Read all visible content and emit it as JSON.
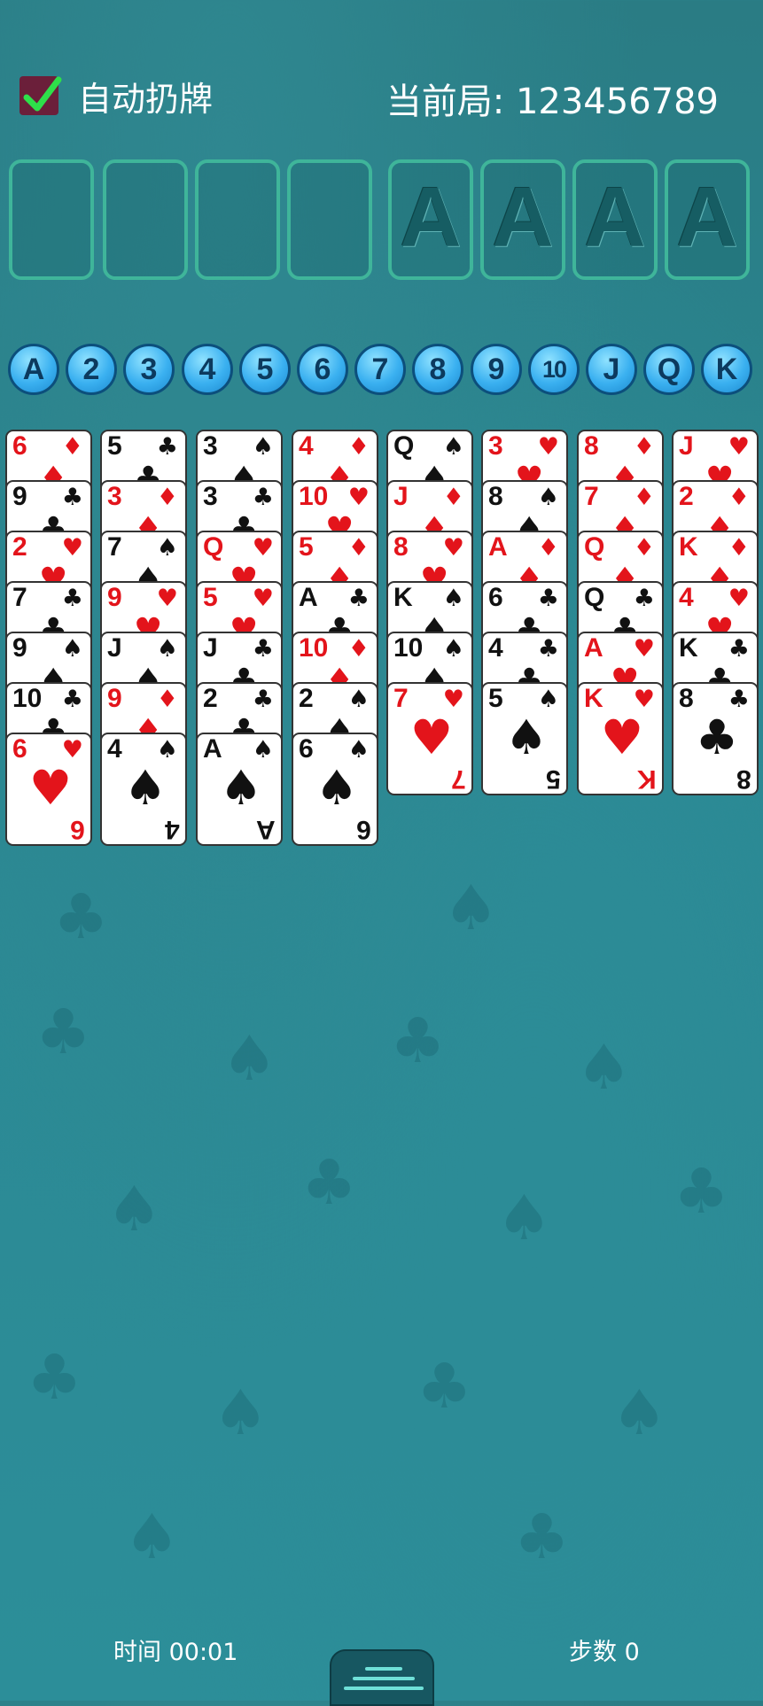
{
  "header": {
    "auto_discard_label": "自动扔牌",
    "auto_discard_checked": true,
    "game_label": "当前局: 123456789"
  },
  "foundations": [
    "A",
    "A",
    "A",
    "A"
  ],
  "free_cells": [
    "",
    "",
    "",
    ""
  ],
  "rank_buttons": [
    "A",
    "2",
    "3",
    "4",
    "5",
    "6",
    "7",
    "8",
    "9",
    "10",
    "J",
    "Q",
    "K"
  ],
  "tableau": [
    [
      {
        "r": "6",
        "s": "♦"
      },
      {
        "r": "9",
        "s": "♣"
      },
      {
        "r": "2",
        "s": "♥"
      },
      {
        "r": "7",
        "s": "♣"
      },
      {
        "r": "9",
        "s": "♠"
      },
      {
        "r": "10",
        "s": "♣"
      },
      {
        "r": "6",
        "s": "♥"
      }
    ],
    [
      {
        "r": "5",
        "s": "♣"
      },
      {
        "r": "3",
        "s": "♦"
      },
      {
        "r": "7",
        "s": "♠"
      },
      {
        "r": "9",
        "s": "♥"
      },
      {
        "r": "J",
        "s": "♠"
      },
      {
        "r": "9",
        "s": "♦"
      },
      {
        "r": "4",
        "s": "♠"
      }
    ],
    [
      {
        "r": "3",
        "s": "♠"
      },
      {
        "r": "3",
        "s": "♣"
      },
      {
        "r": "Q",
        "s": "♥"
      },
      {
        "r": "5",
        "s": "♥"
      },
      {
        "r": "J",
        "s": "♣"
      },
      {
        "r": "2",
        "s": "♣"
      },
      {
        "r": "A",
        "s": "♠"
      }
    ],
    [
      {
        "r": "4",
        "s": "♦"
      },
      {
        "r": "10",
        "s": "♥"
      },
      {
        "r": "5",
        "s": "♦"
      },
      {
        "r": "A",
        "s": "♣"
      },
      {
        "r": "10",
        "s": "♦"
      },
      {
        "r": "2",
        "s": "♠"
      },
      {
        "r": "6",
        "s": "♠"
      }
    ],
    [
      {
        "r": "Q",
        "s": "♠"
      },
      {
        "r": "J",
        "s": "♦"
      },
      {
        "r": "8",
        "s": "♥"
      },
      {
        "r": "K",
        "s": "♠"
      },
      {
        "r": "10",
        "s": "♠"
      },
      {
        "r": "7",
        "s": "♥"
      }
    ],
    [
      {
        "r": "3",
        "s": "♥"
      },
      {
        "r": "8",
        "s": "♠"
      },
      {
        "r": "A",
        "s": "♦"
      },
      {
        "r": "6",
        "s": "♣"
      },
      {
        "r": "4",
        "s": "♣"
      },
      {
        "r": "5",
        "s": "♠"
      }
    ],
    [
      {
        "r": "8",
        "s": "♦"
      },
      {
        "r": "7",
        "s": "♦"
      },
      {
        "r": "Q",
        "s": "♦"
      },
      {
        "r": "Q",
        "s": "♣"
      },
      {
        "r": "A",
        "s": "♥"
      },
      {
        "r": "K",
        "s": "♥"
      }
    ],
    [
      {
        "r": "J",
        "s": "♥"
      },
      {
        "r": "2",
        "s": "♦"
      },
      {
        "r": "K",
        "s": "♦"
      },
      {
        "r": "4",
        "s": "♥"
      },
      {
        "r": "K",
        "s": "♣"
      },
      {
        "r": "8",
        "s": "♣"
      }
    ]
  ],
  "footer": {
    "time_label": "时间 00:01",
    "steps_label": "步数 0"
  },
  "colors": {
    "red_suit": "#e3141b",
    "black_suit": "#111111",
    "slot_border": "#3fb59a",
    "table": "#2b8893"
  },
  "icons": {
    "checkbox": "check-icon",
    "menu": "menu-icon"
  }
}
